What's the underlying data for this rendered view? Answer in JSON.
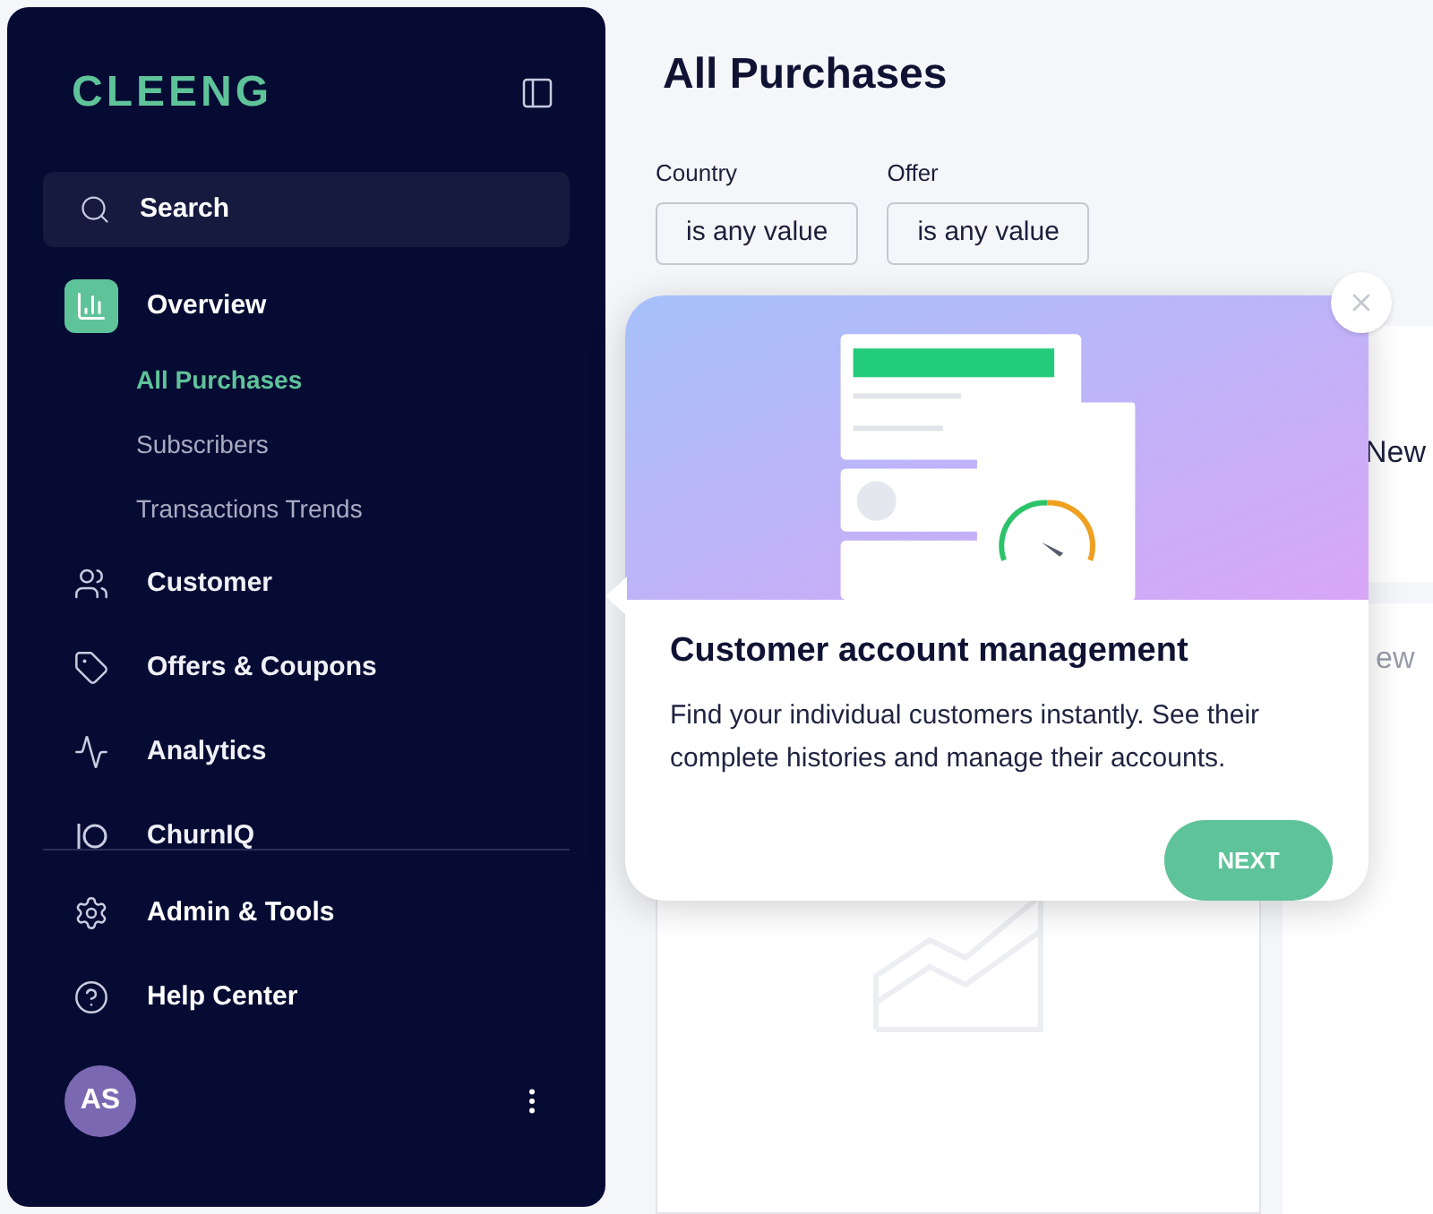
{
  "sidebar": {
    "logo": "CLEENG",
    "search": {
      "label": "Search"
    },
    "nav": [
      {
        "label": "Overview",
        "kind": "chart",
        "selected": true,
        "children": [
          {
            "label": "All Purchases",
            "selected": true
          },
          {
            "label": "Subscribers",
            "selected": false
          },
          {
            "label": "Transactions Trends",
            "selected": false
          }
        ]
      },
      {
        "label": "Customer",
        "kind": "users",
        "selected": false
      },
      {
        "label": "Offers & Coupons",
        "kind": "tag",
        "selected": false
      },
      {
        "label": "Analytics",
        "kind": "pulse",
        "selected": false
      },
      {
        "label": "ChurnIQ",
        "kind": "iq",
        "selected": false
      }
    ],
    "footer": [
      {
        "label": "Admin & Tools",
        "kind": "gear"
      },
      {
        "label": "Help Center",
        "kind": "help"
      }
    ],
    "user": {
      "initials": "AS"
    }
  },
  "page": {
    "title": "All Purchases",
    "filters": [
      {
        "label": "Country",
        "value": "is any value"
      },
      {
        "label": "Offer",
        "value": "is any value"
      }
    ],
    "side_cards": [
      "New",
      "ew"
    ]
  },
  "tour": {
    "title": "Customer account management",
    "body": "Find your individual customers instantly. See their complete histories and manage their accounts.",
    "button": "NEXT"
  }
}
